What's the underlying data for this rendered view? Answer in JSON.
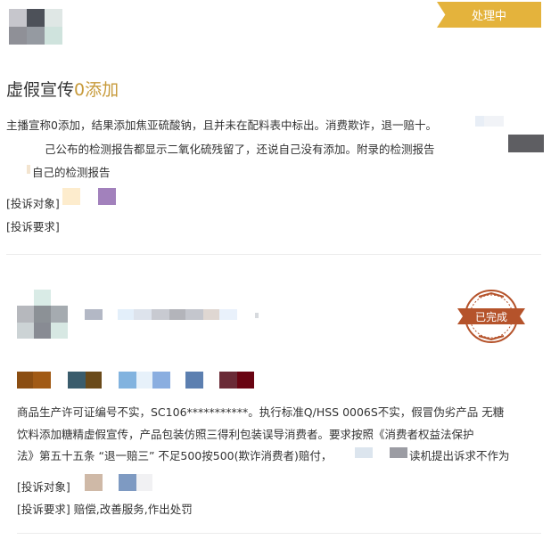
{
  "card1": {
    "status": "处理中",
    "title_prefix": "虚假宣传",
    "title_highlight": "0添加",
    "desc_line1": "主播宣称0添加，结果添加焦亚硫酸钠，且并未在配料表中标出。消费欺诈，退一赔十。",
    "desc_line2": "己公布的检测报告都显示二氧化硫残留了，还说自己没有添加。附录的检测报告",
    "desc_line3": "自己的检测报告",
    "complaint_target_label": "[投诉对象]",
    "complaint_request_label": "[投诉要求]"
  },
  "card2": {
    "status": "已完成",
    "desc_line1": "商品生产许可证编号不实，SC106***********。执行标准Q/HSS 0006S不实，假冒伪劣产品 无糖",
    "desc_line2": "饮料添加糖精虚假宣传，产品包装仿照三得利包装误导消费者。要求按照《消费者权益法保护",
    "desc_line3_a": "法》第五十五条 “退一赔三” 不足500按500(欺诈消费者)赔付，",
    "desc_line3_b": "读机提出诉求不作为",
    "complaint_target_label": "[投诉对象]",
    "complaint_request_label": "[投诉要求]",
    "complaint_request_value": "赔偿,改善服务,作出处罚"
  },
  "colors": {
    "ribbon": "#e4b33c",
    "highlight": "#c79a3a",
    "stamp": "#b5532b"
  }
}
